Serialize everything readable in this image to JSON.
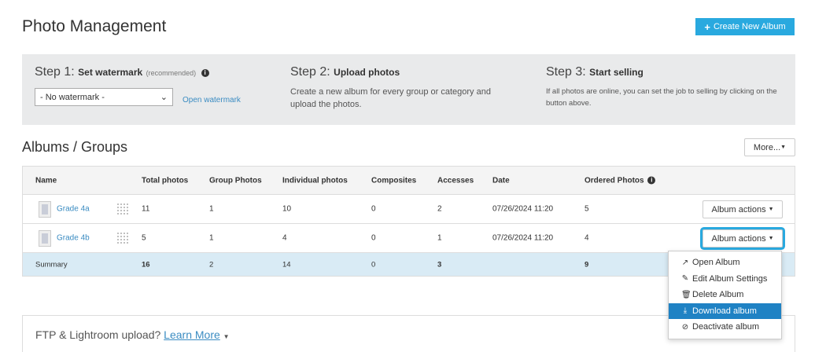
{
  "page": {
    "title": "Photo Management"
  },
  "header": {
    "create_label": "Create New Album",
    "create_icon": "plus-icon"
  },
  "steps": [
    {
      "num": "Step 1:",
      "title": "Set watermark",
      "note": "(recommended)",
      "select_value": "- No watermark -",
      "link": "Open watermark"
    },
    {
      "num": "Step 2:",
      "title": "Upload photos",
      "text": "Create a new album for every group or category and upload the photos."
    },
    {
      "num": "Step 3:",
      "title": "Start selling",
      "text": "If all photos are online, you can set the job to selling by clicking on the button above."
    }
  ],
  "albums": {
    "title": "Albums / Groups",
    "more_label": "More...",
    "columns": [
      "Name",
      "Total photos",
      "Group Photos",
      "Individual photos",
      "Composites",
      "Accesses",
      "Date",
      "Ordered Photos"
    ],
    "rows": [
      {
        "name": "Grade 4a",
        "total": "11",
        "group": "1",
        "individual": "10",
        "composites": "0",
        "accesses": "2",
        "date": "07/26/2024 11:20",
        "ordered": "5",
        "action_label": "Album actions"
      },
      {
        "name": "Grade 4b",
        "total": "5",
        "group": "1",
        "individual": "4",
        "composites": "0",
        "accesses": "1",
        "date": "07/26/2024 11:20",
        "ordered": "4",
        "action_label": "Album actions"
      }
    ],
    "summary": {
      "label": "Summary",
      "total": "16",
      "group": "2",
      "individual": "14",
      "composites": "0",
      "accesses": "3",
      "ordered": "9"
    }
  },
  "dropdown": {
    "items": [
      {
        "label": "Open Album",
        "icon": "external-link-icon"
      },
      {
        "label": "Edit Album Settings",
        "icon": "pencil-icon"
      },
      {
        "label": "Delete Album",
        "icon": "trash-icon"
      },
      {
        "label": "Download album",
        "icon": "download-icon",
        "active": true
      },
      {
        "label": "Deactivate album",
        "icon": "ban-icon"
      }
    ]
  },
  "ftp": {
    "text": "FTP & Lightroom upload?",
    "link": "Learn More"
  },
  "colors": {
    "accent": "#29a9df",
    "link": "#3b8cc2",
    "active": "#1f82c4",
    "summary_bg": "#d9ebf5"
  }
}
